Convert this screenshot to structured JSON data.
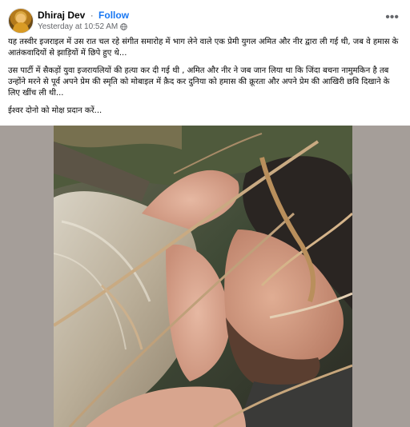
{
  "post": {
    "author": "Dhiraj Dev",
    "separator": "·",
    "follow_label": "Follow",
    "timestamp": "Yesterday at 10:52 AM",
    "audience_icon": "globe-icon",
    "more_icon": "more-horizontal-icon",
    "paragraphs": [
      "यह तस्वीर इजराइल में उस रात चल रहे संगीत समारोह में भाग लेने वाले एक प्रेमी युगल अमित और नीर द्वारा ली गई थी, जब वे हमास के आतंकवादियों से झाड़ियों में छिपे हुए थे...",
      "उस पार्टी में सैकड़ों युवा इजरायलियों की हत्या कर दी गई थी , अमित और नीर ने जब जान लिया था कि जिंदा बचना नामुमकिन है तब उन्होंने मरने से पूर्व अपने प्रेम की स्मृति को मोबाइल में क़ैद कर दुनिया को हमास की क्रूरता और अपने प्रेम की आखिरी छवि दिखाने के लिए खींच ली थी...",
      "ईश्वर दोनो को मोक्ष प्रदान करें..."
    ]
  },
  "colors": {
    "link_blue": "#1877f2",
    "secondary_text": "#65676b",
    "media_background": "#a59e99"
  }
}
